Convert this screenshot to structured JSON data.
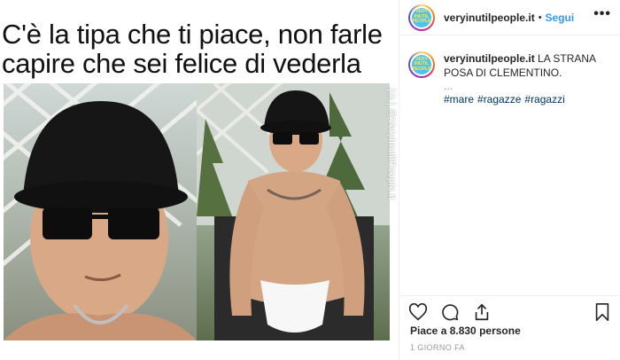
{
  "meme": {
    "caption": "C'è la tipa che ti piace, non farle capire che sei felice di vederla",
    "watermark": "[©] @VeryInutilPeople.it"
  },
  "header": {
    "username": "veryinutilpeople.it",
    "separator": "•",
    "follow_label": "Segui",
    "more_label": "•••",
    "avatar_text": "VERY INUTIL PEOPLE"
  },
  "post": {
    "username": "veryinutilpeople.it",
    "caption": "LA STRANA POSA DI CLEMENTINO.",
    "ellipsis": "...",
    "hashtags": [
      "#mare",
      "#ragazze",
      "#ragazzi"
    ]
  },
  "actions": {
    "icons": [
      "heart-icon",
      "comment-icon",
      "share-icon",
      "bookmark-icon"
    ]
  },
  "likes_text": "Piace a 8.830 persone",
  "time_ago": "1 GIORNO FA",
  "colors": {
    "link_blue": "#3897f0",
    "hashtag_blue": "#003569",
    "text": "#262626",
    "muted": "#999999",
    "divider": "#efefef"
  }
}
